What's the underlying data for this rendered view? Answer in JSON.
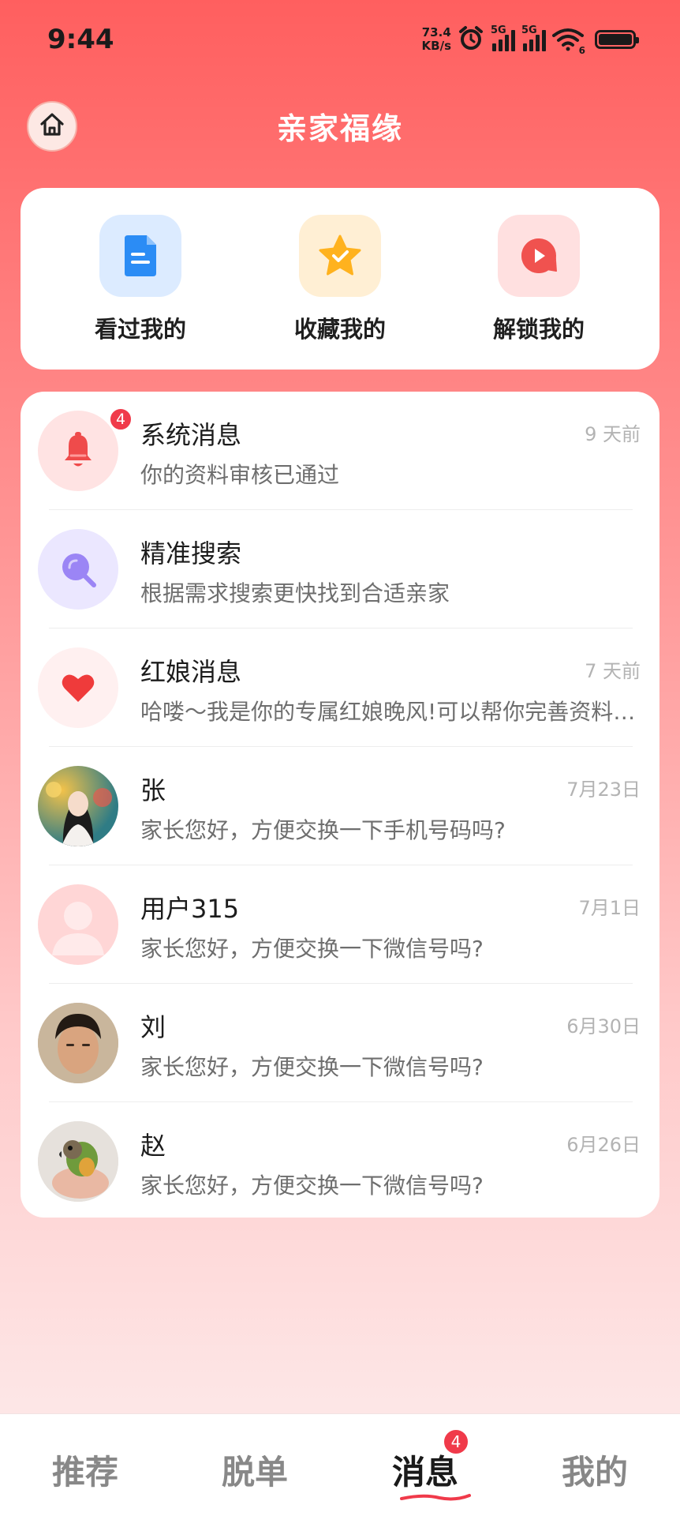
{
  "status_bar": {
    "time": "9:44",
    "net_speed_value": "73.4",
    "net_speed_unit": "KB/s",
    "sim1_label": "5G",
    "sim2_label": "5G",
    "wifi_badge": "6"
  },
  "header": {
    "title": "亲家福缘",
    "home_icon": "home-icon"
  },
  "quick_actions": [
    {
      "label": "看过我的",
      "icon": "document-icon",
      "color": "#2b8cf5"
    },
    {
      "label": "收藏我的",
      "icon": "star-icon",
      "color": "#ffb21e"
    },
    {
      "label": "解锁我的",
      "icon": "play-chat-icon",
      "color": "#f0524f"
    }
  ],
  "messages": [
    {
      "name": "系统消息",
      "preview": "你的资料审核已通过",
      "time": "9 天前",
      "badge": "4",
      "icon": "bell-icon"
    },
    {
      "name": "精准搜索",
      "preview": "根据需求搜索更快找到合适亲家",
      "time": "",
      "icon": "search-icon"
    },
    {
      "name": "红娘消息",
      "preview": "哈喽～我是你的专属红娘晚风!可以帮你完善资料，推荐合适亲家",
      "time": "7 天前",
      "icon": "heart-icon"
    },
    {
      "name": "张",
      "preview": "家长您好，方便交换一下手机号码吗?",
      "time": "7月23日",
      "icon": "avatar-photo"
    },
    {
      "name": "用户315",
      "preview": "家长您好，方便交换一下微信号吗?",
      "time": "7月1日",
      "icon": "default-user-icon"
    },
    {
      "name": "刘",
      "preview": "家长您好，方便交换一下微信号吗?",
      "time": "6月30日",
      "icon": "avatar-photo"
    },
    {
      "name": "赵",
      "preview": "家长您好，方便交换一下微信号吗?",
      "time": "6月26日",
      "icon": "avatar-photo"
    }
  ],
  "bottom_nav": {
    "items": [
      {
        "label": "推荐"
      },
      {
        "label": "脱单"
      },
      {
        "label": "消息",
        "badge": "4",
        "active": true
      },
      {
        "label": "我的"
      }
    ]
  },
  "colors": {
    "accent": "#f03a4a",
    "header_gradient_top": "#ff5f5f"
  }
}
